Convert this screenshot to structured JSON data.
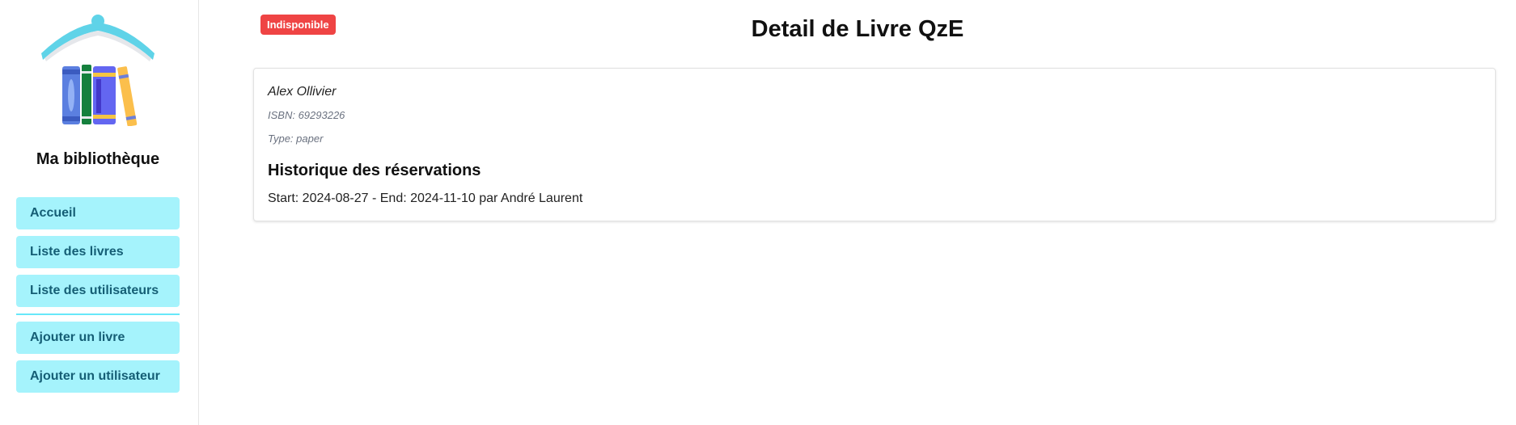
{
  "sidebar": {
    "brand": "Ma bibliothèque",
    "logo_icon": "books-logo-icon",
    "nav": [
      {
        "label": "Accueil"
      },
      {
        "label": "Liste des livres"
      },
      {
        "label": "Liste des utilisateurs"
      },
      {
        "label": "Ajouter un livre"
      },
      {
        "label": "Ajouter un utilisateur"
      }
    ]
  },
  "main": {
    "status_badge": "Indisponible",
    "title": "Detail de Livre QzE",
    "book": {
      "author": "Alex Ollivier",
      "isbn": "ISBN: 69293226",
      "type": "Type: paper"
    },
    "history": {
      "title": "Historique des réservations",
      "entries": [
        "Start: 2024-08-27 - End: 2024-11-10 par André Laurent"
      ]
    }
  },
  "colors": {
    "nav_bg": "#a5f3fc",
    "nav_text": "#155e75",
    "divider": "#67e8f9",
    "badge_bg": "#ef4444"
  }
}
